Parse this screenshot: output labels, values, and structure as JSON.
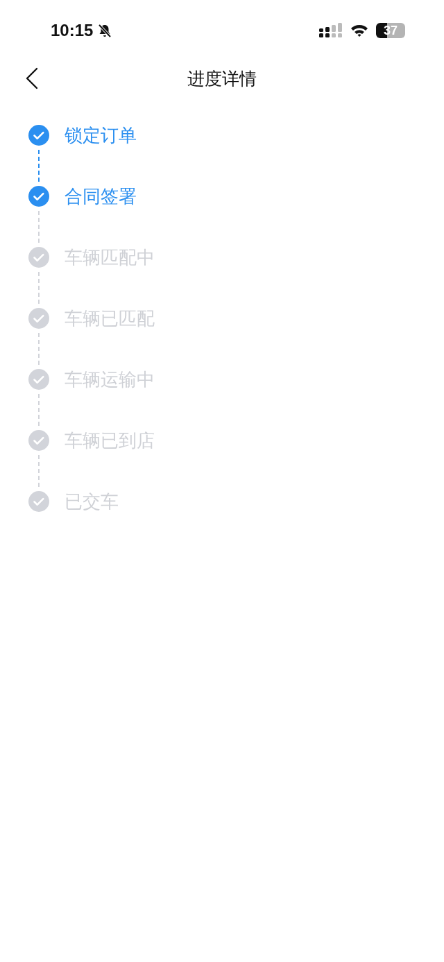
{
  "status_bar": {
    "time": "10:15",
    "battery": "37"
  },
  "header": {
    "title": "进度详情"
  },
  "steps": [
    {
      "label": "锁定订单",
      "done": true
    },
    {
      "label": "合同签署",
      "done": true
    },
    {
      "label": "车辆匹配中",
      "done": false
    },
    {
      "label": "车辆已匹配",
      "done": false
    },
    {
      "label": "车辆运输中",
      "done": false
    },
    {
      "label": "车辆已到店",
      "done": false
    },
    {
      "label": "已交车",
      "done": false
    }
  ]
}
